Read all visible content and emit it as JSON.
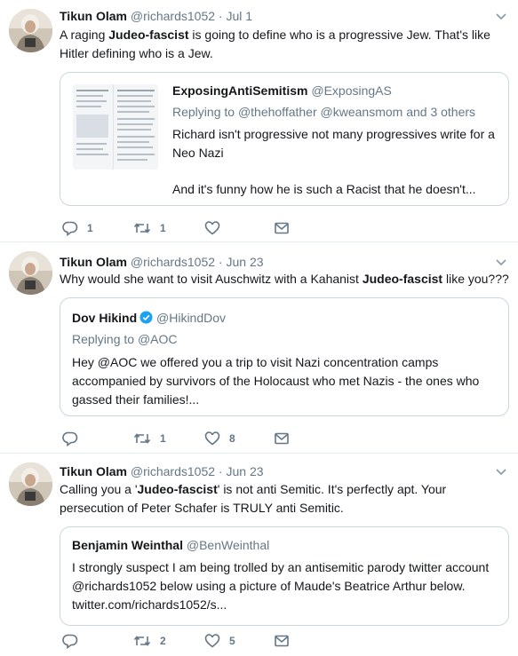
{
  "tweets": [
    {
      "author_name": "Tikun Olam",
      "author_handle": "@richards1052",
      "separator": "·",
      "date": "Jul 1",
      "text_parts": [
        "A raging ",
        "Judeo-fascist",
        " is going to define who is a progressive Jew. That's like Hitler defining who is a Jew."
      ],
      "quote": {
        "author_name": "ExposingAntiSemitism",
        "author_handle": "@ExposingAS",
        "reply_prefix": "Replying to ",
        "reply_targets": "@thehoffather @kweansmom and 3 others",
        "body_line1": "Richard isn't progressive not many progressives write for a Neo Nazi",
        "body_line2": "And it's funny how he is such a Racist that he doesn't..."
      },
      "actions": {
        "reply_count": "1",
        "retweet_count": "1",
        "like_count": ""
      }
    },
    {
      "author_name": "Tikun Olam",
      "author_handle": "@richards1052",
      "separator": "·",
      "date": "Jun 23",
      "text_parts": [
        "Why would she want to visit Auschwitz with a Kahanist ",
        "Judeo-fascist",
        " like you???"
      ],
      "quote": {
        "author_name": "Dov Hikind",
        "author_handle": "@HikindDov",
        "reply_prefix": "Replying to ",
        "reply_targets": "@AOC",
        "body": "Hey @AOC we offered you a trip to visit Nazi concentration camps accompanied by survivors of the Holocaust who met Nazis - the ones who gassed their families!..."
      },
      "actions": {
        "reply_count": "",
        "retweet_count": "1",
        "like_count": "8"
      }
    },
    {
      "author_name": "Tikun Olam",
      "author_handle": "@richards1052",
      "separator": "·",
      "date": "Jun 23",
      "text_parts": [
        "Calling you a '",
        "Judeo-fascist",
        "' is not anti Semitic. It's perfectly apt. Your persecution of Peter Schafer is TRULY anti Semitic."
      ],
      "quote": {
        "author_name": "Benjamin Weinthal",
        "author_handle": "@BenWeinthal",
        "body": "I strongly suspect I am being trolled by an antisemitic parody twitter account @richards1052 below using a picture of Maude's Beatrice Arthur  below. twitter.com/richards1052/s..."
      },
      "actions": {
        "reply_count": "",
        "retweet_count": "2",
        "like_count": "5"
      }
    }
  ],
  "colors": {
    "text": "#14171a",
    "muted": "#657786",
    "link": "#1da1f2",
    "border": "#e6ecf0",
    "quote_border": "#ccd6dd",
    "verified": "#1da1f2"
  },
  "icons": [
    "avatar",
    "chevron-down-icon",
    "reply-icon",
    "retweet-icon",
    "like-icon",
    "dm-icon",
    "verified-badge-icon",
    "quote-media-thumbnail"
  ]
}
